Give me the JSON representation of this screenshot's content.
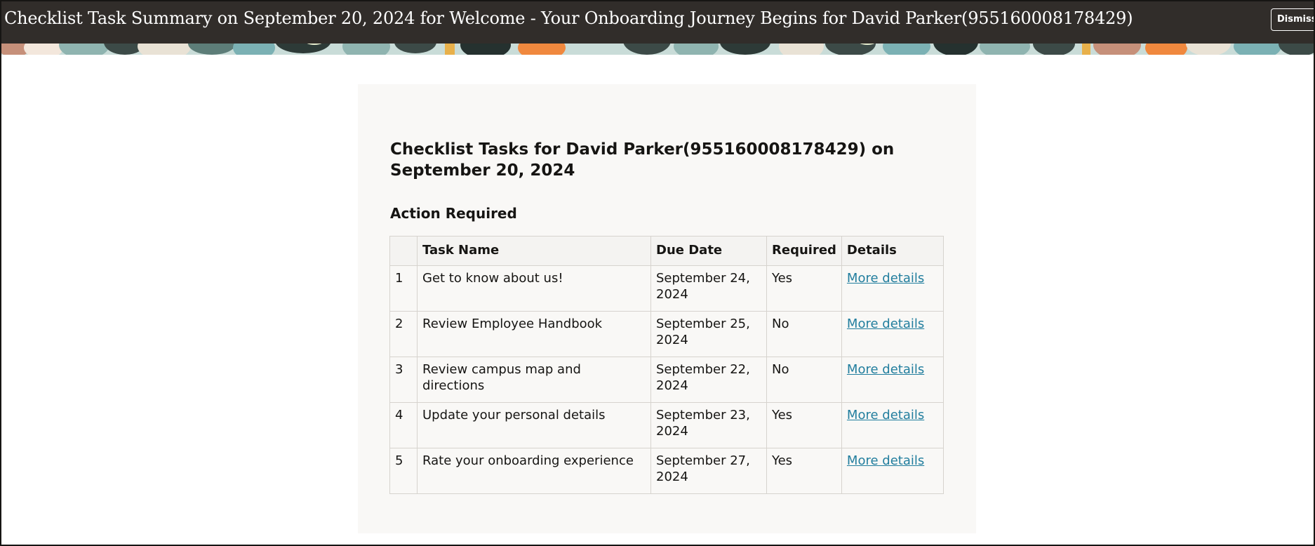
{
  "header": {
    "title": "Checklist Task Summary on September 20, 2024 for Welcome - Your Onboarding Journey Begins for David Parker(955160008178429)",
    "dismiss_label": "Dismiss"
  },
  "colors": {
    "header_bg": "#312d2a",
    "card_bg": "#f9f8f6",
    "link": "#227e9e"
  },
  "card": {
    "title": "Checklist Tasks for David Parker(955160008178429) on September 20, 2024",
    "section_title": "Action Required"
  },
  "table": {
    "columns": [
      "",
      "Task Name",
      "Due Date",
      "Required",
      "Details"
    ],
    "rows": [
      {
        "num": "1",
        "name": "Get to know about us!",
        "due": "September 24, 2024",
        "required": "Yes",
        "details": "More details"
      },
      {
        "num": "2",
        "name": "Review Employee Handbook",
        "due": "September 25, 2024",
        "required": "No",
        "details": "More details"
      },
      {
        "num": "3",
        "name": "Review campus map and directions",
        "due": "September 22, 2024",
        "required": "No",
        "details": "More details"
      },
      {
        "num": "4",
        "name": "Update your personal details",
        "due": "September 23, 2024",
        "required": "Yes",
        "details": "More details"
      },
      {
        "num": "5",
        "name": "Rate your onboarding experience",
        "due": "September 27, 2024",
        "required": "Yes",
        "details": "More details"
      }
    ]
  }
}
